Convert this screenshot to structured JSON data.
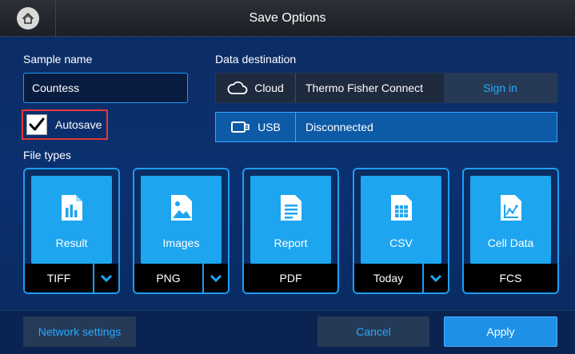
{
  "window": {
    "title": "Save Options"
  },
  "sample": {
    "label": "Sample name",
    "value": "Countess"
  },
  "autosave": {
    "label": "Autosave",
    "checked": true
  },
  "destination": {
    "label": "Data destination",
    "cloud": {
      "type": "Cloud",
      "status": "Thermo Fisher Connect",
      "action": "Sign in"
    },
    "usb": {
      "type": "USB",
      "status": "Disconnected"
    }
  },
  "file_types": {
    "label": "File types",
    "items": [
      {
        "name": "Result",
        "value": "TIFF",
        "has_dropdown": true,
        "icon": "result-chart-icon"
      },
      {
        "name": "Images",
        "value": "PNG",
        "has_dropdown": true,
        "icon": "image-file-icon"
      },
      {
        "name": "Report",
        "value": "PDF",
        "has_dropdown": false,
        "icon": "report-file-icon"
      },
      {
        "name": "CSV",
        "value": "Today",
        "has_dropdown": true,
        "icon": "csv-file-icon"
      },
      {
        "name": "Cell Data",
        "value": "FCS",
        "has_dropdown": false,
        "icon": "cell-data-file-icon"
      }
    ]
  },
  "footer": {
    "network_label": "Network settings",
    "cancel_label": "Cancel",
    "apply_label": "Apply"
  },
  "colors": {
    "accent": "#1ea5f0",
    "link": "#29a9ff",
    "highlight_border": "#e53935"
  }
}
